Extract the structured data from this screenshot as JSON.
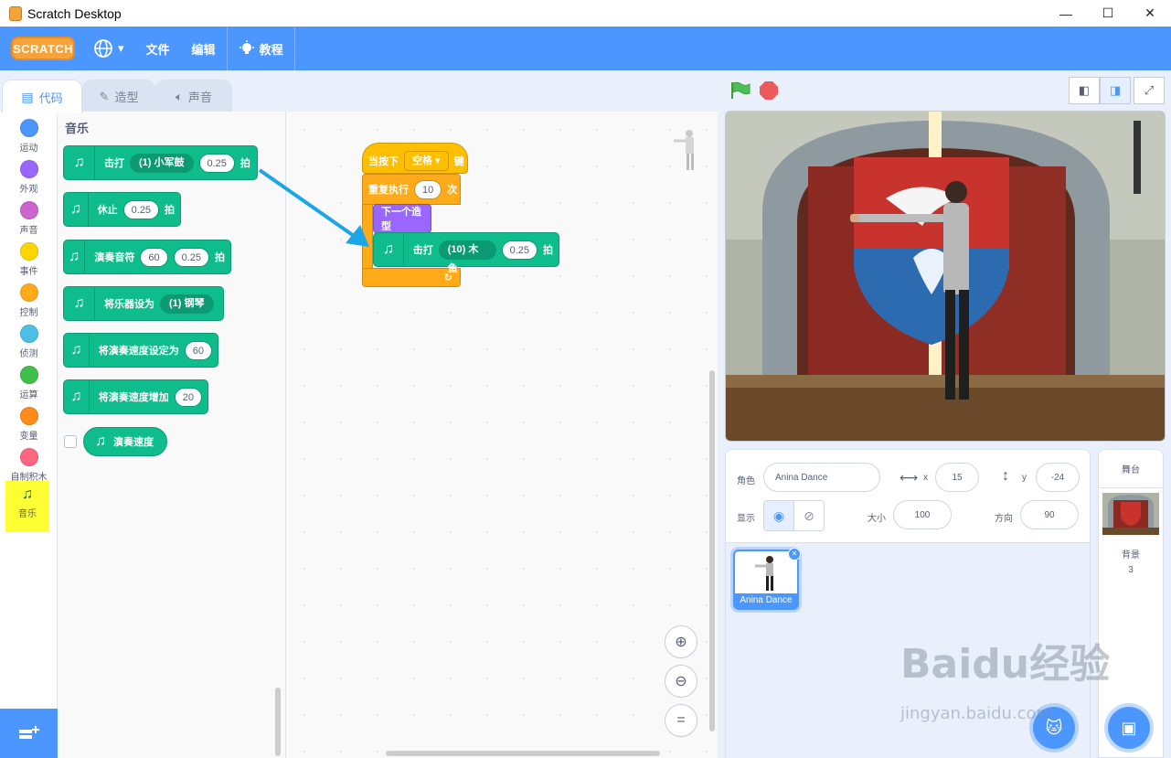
{
  "window": {
    "title": "Scratch Desktop",
    "min": "—",
    "max": "☐",
    "close": "✕"
  },
  "menu": {
    "logo": "SCRATCH",
    "file": "文件",
    "edit": "编辑",
    "tutorials": "教程",
    "language_caret": "▾"
  },
  "tabs": [
    {
      "label": "代码"
    },
    {
      "label": "造型"
    },
    {
      "label": "声音"
    }
  ],
  "categories": [
    {
      "label": "运动",
      "color": "#4c97ff"
    },
    {
      "label": "外观",
      "color": "#9966ff"
    },
    {
      "label": "声音",
      "color": "#cf63cf"
    },
    {
      "label": "事件",
      "color": "#ffd500"
    },
    {
      "label": "控制",
      "color": "#ffab19"
    },
    {
      "label": "侦测",
      "color": "#4cbfe6"
    },
    {
      "label": "运算",
      "color": "#40bf4a"
    },
    {
      "label": "变量",
      "color": "#ff8c1a"
    },
    {
      "label": "自制积木",
      "color": "#ff6680"
    },
    {
      "label": "音乐",
      "color": "#0fbd8c"
    }
  ],
  "flyout": {
    "heading": "音乐",
    "b1": {
      "text": "击打",
      "drum": "(1) 小军鼓",
      "beats": "0.25",
      "unit": "拍"
    },
    "b2": {
      "text": "休止",
      "beats": "0.25",
      "unit": "拍"
    },
    "b3": {
      "text": "演奏音符",
      "note": "60",
      "beats": "0.25",
      "unit": "拍"
    },
    "b4": {
      "text": "将乐器设为",
      "instrument": "(1) 钢琴"
    },
    "b5": {
      "text": "将演奏速度设定为",
      "value": "60"
    },
    "b6": {
      "text": "将演奏速度增加",
      "value": "20"
    },
    "b7": {
      "text": "演奏速度"
    }
  },
  "script": {
    "when_key": "当按下",
    "key": "空格",
    "key_suffix": "键",
    "repeat": "重复执行",
    "times": "10",
    "times_suffix": "次",
    "next_costume": "下一个造型",
    "play_drum": "击打",
    "drum": "(10) 木鱼",
    "beats": "0.25",
    "unit": "拍"
  },
  "sprite": {
    "label_sprite": "角色",
    "name": "Anina Dance",
    "x_label": "x",
    "x": "15",
    "y_label": "y",
    "y": "-24",
    "show_label": "显示",
    "size_label": "大小",
    "size": "100",
    "dir_label": "方向",
    "direction": "90",
    "thumb_name": "Anina Dance"
  },
  "stage_panel": {
    "title": "舞台",
    "backdrop_label": "背景",
    "backdrop_count": "3"
  },
  "watermark": {
    "text": "Baidu经验",
    "url": "jingyan.baidu.com"
  }
}
